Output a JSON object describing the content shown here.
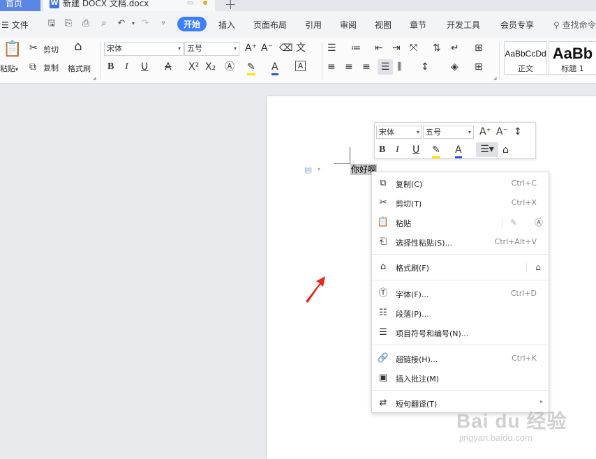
{
  "titlebar": {
    "home_tab": "首页",
    "doc_tab": "新建 DOCX 文档.docx",
    "doc_icon": "W"
  },
  "menubar": {
    "file": "文件",
    "tabs": [
      "开始",
      "插入",
      "页面布局",
      "引用",
      "审阅",
      "视图",
      "章节",
      "开发工具",
      "会员专享"
    ],
    "active_tab": "开始",
    "search": "查找命令"
  },
  "ribbon": {
    "paste": "粘贴",
    "cut": "剪切",
    "copy": "复制",
    "format_painter": "格式刷",
    "font": "宋体",
    "size": "五号",
    "styles": [
      {
        "sample": "AaBbCcDd",
        "name": "正文"
      },
      {
        "sample": "AaBb",
        "name": "标题 1"
      }
    ]
  },
  "document": {
    "selected_text": "你好啊"
  },
  "mini_toolbar": {
    "font": "宋体",
    "size": "五号"
  },
  "context_menu": {
    "items": [
      {
        "label": "复制(C)",
        "shortcut": "Ctrl+C"
      },
      {
        "label": "剪切(T)",
        "shortcut": "Ctrl+X"
      },
      {
        "label": "粘贴",
        "shortcut": ""
      },
      {
        "label": "选择性粘贴(S)...",
        "shortcut": "Ctrl+Alt+V"
      },
      {
        "label": "格式刷(F)",
        "shortcut": ""
      },
      {
        "label": "字体(F)...",
        "shortcut": "Ctrl+D"
      },
      {
        "label": "段落(P)...",
        "shortcut": ""
      },
      {
        "label": "项目符号和编号(N)...",
        "shortcut": ""
      },
      {
        "label": "超链接(H)...",
        "shortcut": "Ctrl+K"
      },
      {
        "label": "插入批注(M)",
        "shortcut": ""
      },
      {
        "label": "短句翻译(T)",
        "shortcut": ""
      }
    ]
  },
  "watermark": {
    "main": "Bai du 经验",
    "sub": "jingyan.baidu.com"
  },
  "colors": {
    "accent": "#3d7eff",
    "highlight": "#ffe600",
    "font_color": "#2b56e0",
    "arrow": "#e8261c"
  }
}
